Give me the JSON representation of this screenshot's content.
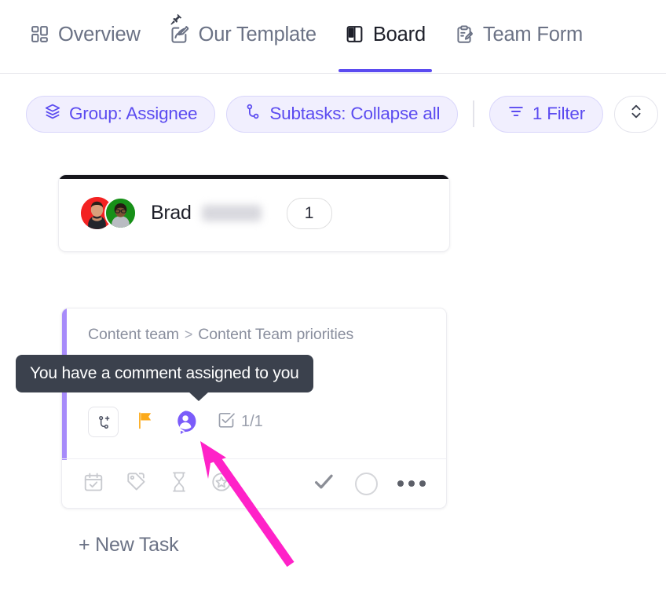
{
  "tabs": [
    {
      "label": "Overview",
      "icon": "grid-dashboard-icon",
      "active": false
    },
    {
      "label": "Our Template",
      "icon": "doc-pencil-icon",
      "active": false,
      "pinned": true
    },
    {
      "label": "Board",
      "icon": "board-columns-icon",
      "active": true
    },
    {
      "label": "Team Form",
      "icon": "clipboard-pencil-icon",
      "active": false
    }
  ],
  "toolbar": {
    "group_label": "Group: Assignee",
    "group_icon": "layers-icon",
    "subtasks_label": "Subtasks: Collapse all",
    "subtasks_icon": "subtask-branch-icon",
    "filter_label": "1 Filter",
    "filter_icon": "filter-lines-icon",
    "sort_icon": "chevron-up-down-icon"
  },
  "group_header": {
    "name": "Brad",
    "surname_redacted": true,
    "count": "1",
    "avatars": [
      {
        "name": "avatar-brad",
        "ring_color": "#f32222"
      },
      {
        "name": "avatar-teammate",
        "ring_color": "#179018"
      }
    ]
  },
  "task_card": {
    "breadcrumb_parent": "Content team",
    "breadcrumb_separator": ">",
    "breadcrumb_child": "Content Team priorities",
    "accent_color": "#a78bfa",
    "icons": {
      "add_subtask": "add-subtask-icon",
      "priority_flag": "flag-icon",
      "comment_assigned": "assigned-comment-icon",
      "checklist_label": "1/1",
      "checklist_icon": "checkbox-checked-icon"
    },
    "footer_icons": [
      "calendar-check-icon",
      "tags-icon",
      "hourglass-icon",
      "star-circle-icon"
    ],
    "footer_actions": [
      "checkmark-icon",
      "status-circle-icon",
      "more-options-icon"
    ]
  },
  "new_task_label": "+ New Task",
  "tooltip": {
    "text": "You have a comment assigned to you",
    "background": "#3b414d"
  },
  "annotation": {
    "arrow_color": "#ff22c8"
  },
  "colors": {
    "accent_purple": "#5b4bf0",
    "pill_fill": "#f1effe",
    "pill_border": "#d9d6fb",
    "flag_orange": "#fcaa1a",
    "card_accent": "#a78bfa"
  }
}
